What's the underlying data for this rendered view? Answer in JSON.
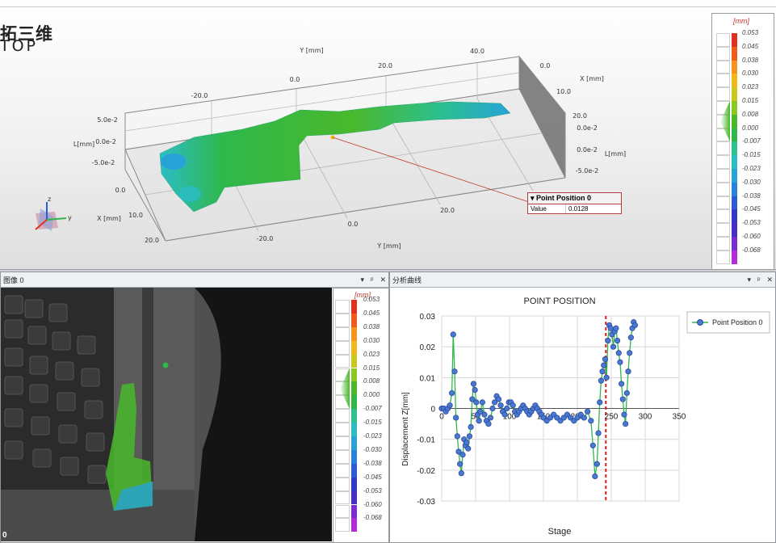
{
  "logo": {
    "line1": "拓三维",
    "line2": "TOP"
  },
  "viewer3d": {
    "axis_labels": {
      "y_top": "Y [mm]",
      "x_right": "X [mm]",
      "l_left": "L[mm]",
      "l_right": "L[mm]",
      "x_left": "X [mm]",
      "y_bottom": "Y [mm]"
    },
    "y_top_ticks": [
      "-20.0",
      "0.0",
      "20.0",
      "40.0"
    ],
    "x_right_ticks": [
      "0.0",
      "10.0",
      "20.0"
    ],
    "l_left_ticks": [
      "5.0e-2",
      "0.0e-2",
      "-5.0e-2"
    ],
    "l_right_ticks": [
      "0.0e-2",
      "0.0e-2",
      "-5.0e-2"
    ],
    "x_left_ticks": [
      "0.0",
      "10.0",
      "20.0"
    ],
    "y_bottom_ticks": [
      "-20.0",
      "0.0",
      "20.0"
    ],
    "tooltip": {
      "title": "Point Position 0",
      "row_label": "Value",
      "row_value": "0.0128"
    }
  },
  "colorscale": {
    "unit": "[mm]",
    "ticks": [
      "0.053",
      "0.045",
      "0.038",
      "0.030",
      "0.023",
      "0.015",
      "0.008",
      "0.000",
      "-0.007",
      "-0.015",
      "-0.023",
      "-0.030",
      "-0.038",
      "-0.045",
      "-0.053",
      "-0.060",
      "-0.068"
    ],
    "colors": [
      "#e0301e",
      "#f05a1a",
      "#f7921c",
      "#f2b81a",
      "#c9c81c",
      "#8cc823",
      "#49b82c",
      "#2fb84a",
      "#2cc08e",
      "#2bbdc6",
      "#27a3d8",
      "#2780d9",
      "#2b5ad6",
      "#3238c9",
      "#4a2cc8",
      "#7a2bd1",
      "#b22bd6"
    ]
  },
  "image_panel": {
    "title": "图像 0",
    "controls": [
      "▾",
      "ᵖ",
      "✕"
    ],
    "corner_text": "0",
    "colorscale_unit": "[mm]"
  },
  "curve_panel": {
    "title": "分析曲线",
    "controls": [
      "▾",
      "ᵖ",
      "✕"
    ]
  },
  "chart_data": {
    "type": "line",
    "title": "POINT POSITION",
    "xlabel": "Stage",
    "ylabel": "Displacement Z[mm]",
    "xlim": [
      0,
      350
    ],
    "ylim": [
      -0.03,
      0.03
    ],
    "x_ticks": [
      "0",
      "50",
      "100",
      "150",
      "200",
      "250",
      "300",
      "350"
    ],
    "y_ticks": [
      "0.03",
      "0.02",
      "0.01",
      "0",
      "-0.01",
      "-0.02",
      "-0.03"
    ],
    "marker_line_x": 242,
    "series": [
      {
        "name": "Point Position 0",
        "x": [
          0,
          3,
          6,
          9,
          12,
          15,
          17,
          19,
          21,
          23,
          25,
          27,
          29,
          31,
          33,
          35,
          37,
          39,
          41,
          43,
          45,
          47,
          49,
          51,
          53,
          55,
          57,
          60,
          63,
          66,
          69,
          72,
          75,
          78,
          81,
          84,
          87,
          90,
          93,
          96,
          99,
          102,
          105,
          108,
          111,
          114,
          117,
          120,
          123,
          126,
          129,
          132,
          135,
          138,
          141,
          144,
          147,
          150,
          155,
          160,
          165,
          170,
          175,
          180,
          185,
          190,
          195,
          200,
          205,
          210,
          215,
          220,
          223,
          226,
          229,
          231,
          233,
          235,
          237,
          239,
          241,
          243,
          245,
          247,
          249,
          251,
          253,
          255,
          257,
          259,
          261,
          263,
          265,
          267,
          269,
          271,
          273,
          275,
          277,
          279,
          281,
          283,
          285
        ],
        "values": [
          0.0,
          0.0,
          -0.001,
          0.0,
          0.001,
          0.005,
          0.024,
          0.012,
          -0.003,
          -0.009,
          -0.014,
          -0.018,
          -0.021,
          -0.015,
          -0.01,
          -0.012,
          -0.011,
          -0.013,
          -0.009,
          -0.006,
          0.003,
          0.008,
          0.006,
          0.002,
          -0.002,
          -0.004,
          -0.001,
          0.002,
          -0.002,
          -0.004,
          -0.005,
          -0.003,
          0.0,
          0.002,
          0.004,
          0.003,
          0.001,
          -0.001,
          -0.002,
          0.0,
          0.002,
          0.002,
          0.001,
          -0.001,
          -0.002,
          -0.001,
          0.0,
          0.001,
          0.0,
          -0.001,
          -0.002,
          -0.001,
          0.0,
          0.001,
          0.0,
          -0.001,
          -0.002,
          -0.003,
          -0.004,
          -0.003,
          -0.002,
          -0.003,
          -0.004,
          -0.003,
          -0.002,
          -0.003,
          -0.004,
          -0.003,
          -0.002,
          -0.003,
          -0.001,
          -0.004,
          -0.012,
          -0.022,
          -0.018,
          -0.008,
          0.002,
          0.009,
          0.012,
          0.014,
          0.016,
          0.01,
          0.022,
          0.027,
          0.026,
          0.024,
          0.02,
          0.025,
          0.026,
          0.022,
          0.018,
          0.015,
          0.008,
          0.003,
          -0.002,
          -0.005,
          0.005,
          0.012,
          0.018,
          0.023,
          0.026,
          0.028,
          0.027
        ]
      }
    ],
    "legend_position": "top-right"
  }
}
